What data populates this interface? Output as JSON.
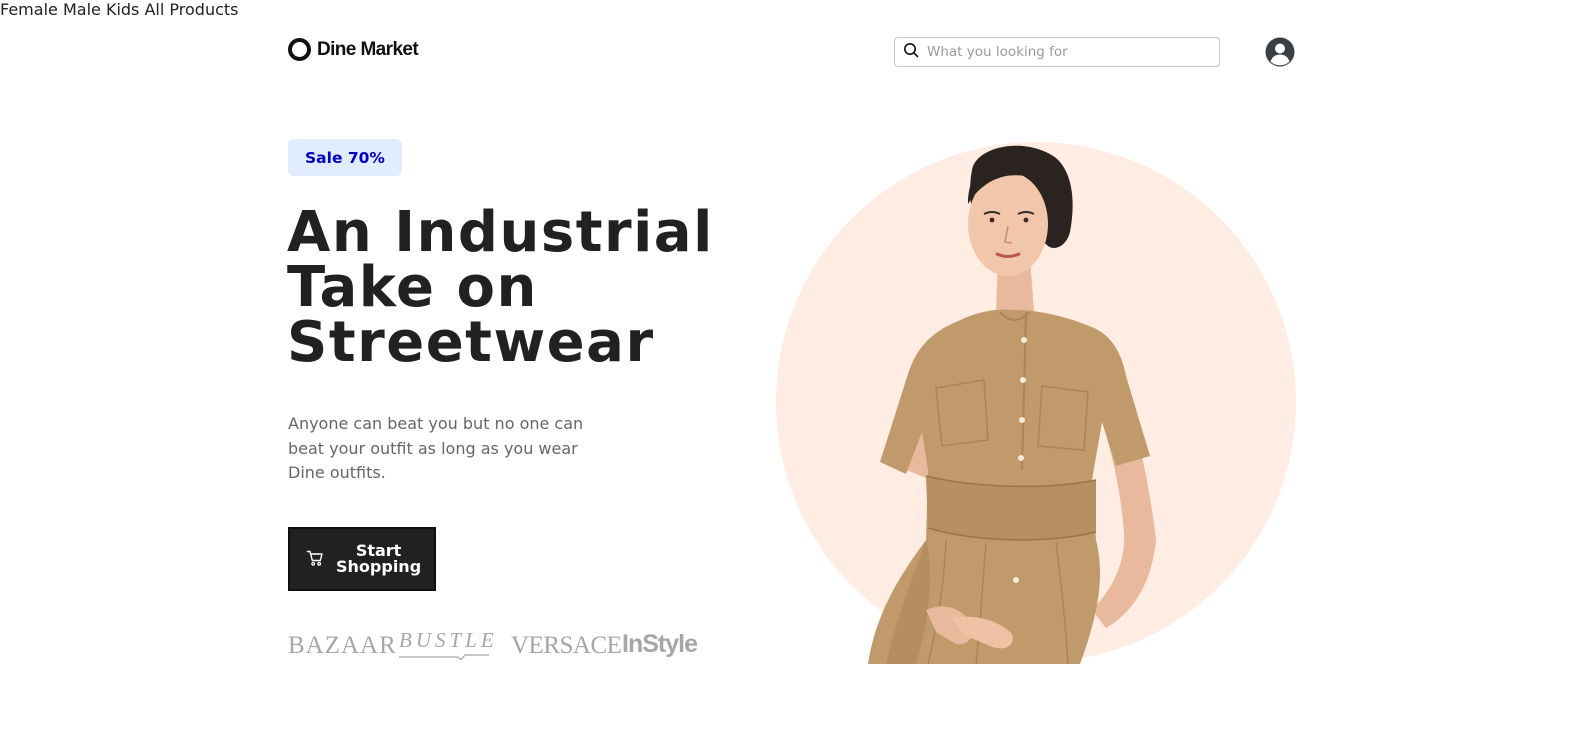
{
  "header": {
    "logo_text": "Dine Market",
    "nav": [
      "Female",
      "Male",
      "Kids",
      "All Products"
    ],
    "search": {
      "placeholder": "What you looking for",
      "value": ""
    }
  },
  "hero": {
    "badge": "Sale 70%",
    "headline": [
      "An Industrial",
      "Take on",
      "Streetwear"
    ],
    "description": [
      "Anyone can beat you but no one can",
      "beat your outfit as long as you wear",
      "Dine outfits."
    ],
    "cta": {
      "line1": "Start",
      "line2": "Shopping"
    },
    "brands": [
      "BAZAAR",
      "BUSTLE",
      "VERSACE",
      "InStyle"
    ]
  },
  "colors": {
    "badge_bg": "#e1edff",
    "badge_text": "#0000c4",
    "hero_circle": "#ffece3",
    "dress": "#c19a6b",
    "cta_bg": "#212121",
    "brand_logo": "#a6a6a6"
  },
  "icons": {
    "search": "search-icon",
    "user": "user-circle-icon",
    "cart": "cart-icon"
  }
}
